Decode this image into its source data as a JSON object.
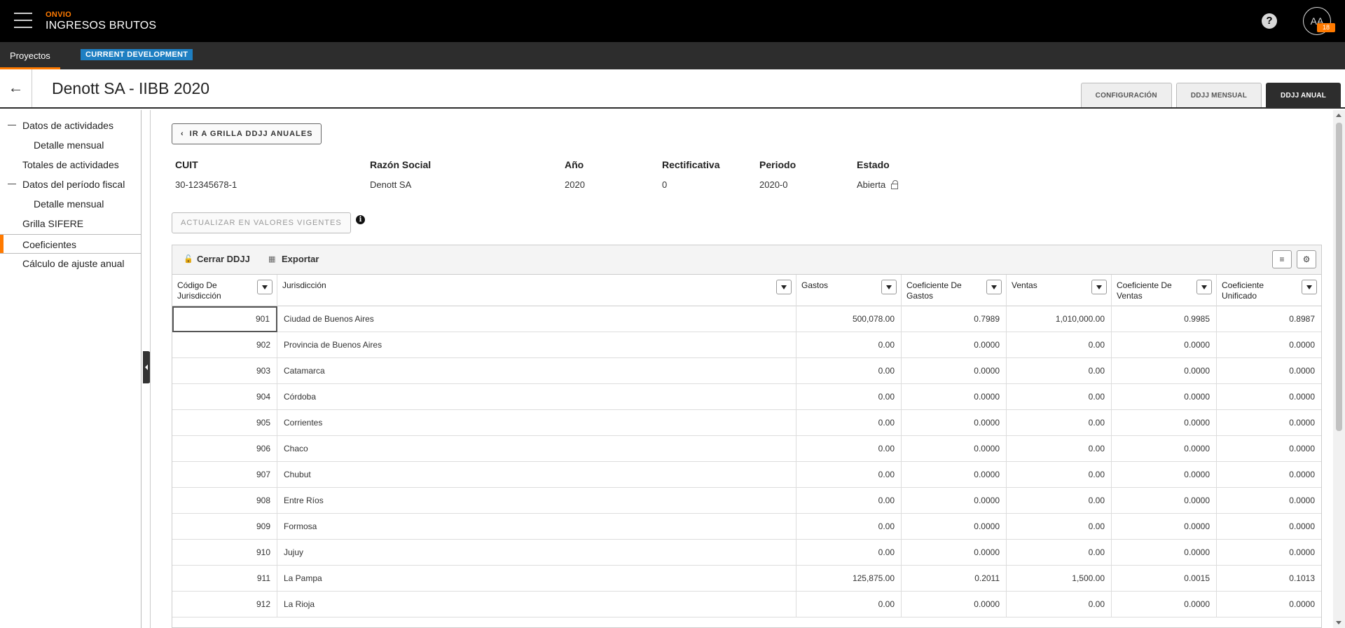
{
  "app": {
    "brand_small": "ONVIO",
    "brand_main": "INGRESOS BRUTOS",
    "help_symbol": "?",
    "avatar_initials": "AA",
    "avatar_badge": "18"
  },
  "nav": {
    "tab": "Proyectos",
    "env_badge": "CURRENT DEVELOPMENT"
  },
  "header": {
    "back_symbol": "←",
    "title": "Denott SA - IIBB 2020",
    "tabs": [
      "CONFIGURACIÓN",
      "DDJJ MENSUAL",
      "DDJJ ANUAL"
    ],
    "active_tab": "DDJJ ANUAL"
  },
  "sidebar": {
    "items": [
      {
        "label": "Datos de actividades"
      },
      {
        "label": "Detalle mensual"
      },
      {
        "label": "Totales de actividades"
      },
      {
        "label": "Datos del período fiscal"
      },
      {
        "label": "Detalle mensual"
      },
      {
        "label": "Grilla SIFERE"
      },
      {
        "label": "Coeficientes"
      },
      {
        "label": "Cálculo de ajuste anual"
      }
    ],
    "active": "Coeficientes"
  },
  "main": {
    "back_grid_button": "IR A GRILLA DDJJ ANUALES",
    "update_button": "ACTUALIZAR EN VALORES VIGENTES",
    "info_symbol": "i",
    "info": {
      "cuit_label": "CUIT",
      "cuit_value": "30-12345678-1",
      "razon_label": "Razón Social",
      "razon_value": "Denott SA",
      "anio_label": "Año",
      "anio_value": "2020",
      "rect_label": "Rectificativa",
      "rect_value": "0",
      "periodo_label": "Periodo",
      "periodo_value": "2020-0",
      "estado_label": "Estado",
      "estado_value": "Abierta"
    }
  },
  "grid": {
    "toolbar": {
      "close_label": "Cerrar DDJJ",
      "export_label": "Exportar"
    },
    "columns": [
      "Código De Jurisdicción",
      "Jurisdicción",
      "Gastos",
      "Coeficiente De Gastos",
      "Ventas",
      "Coeficiente De Ventas",
      "Coeficiente Unificado"
    ],
    "rows": [
      [
        "901",
        "Ciudad de Buenos Aires",
        "500,078.00",
        "0.7989",
        "1,010,000.00",
        "0.9985",
        "0.8987"
      ],
      [
        "902",
        "Provincia de Buenos Aires",
        "0.00",
        "0.0000",
        "0.00",
        "0.0000",
        "0.0000"
      ],
      [
        "903",
        "Catamarca",
        "0.00",
        "0.0000",
        "0.00",
        "0.0000",
        "0.0000"
      ],
      [
        "904",
        "Córdoba",
        "0.00",
        "0.0000",
        "0.00",
        "0.0000",
        "0.0000"
      ],
      [
        "905",
        "Corrientes",
        "0.00",
        "0.0000",
        "0.00",
        "0.0000",
        "0.0000"
      ],
      [
        "906",
        "Chaco",
        "0.00",
        "0.0000",
        "0.00",
        "0.0000",
        "0.0000"
      ],
      [
        "907",
        "Chubut",
        "0.00",
        "0.0000",
        "0.00",
        "0.0000",
        "0.0000"
      ],
      [
        "908",
        "Entre Ríos",
        "0.00",
        "0.0000",
        "0.00",
        "0.0000",
        "0.0000"
      ],
      [
        "909",
        "Formosa",
        "0.00",
        "0.0000",
        "0.00",
        "0.0000",
        "0.0000"
      ],
      [
        "910",
        "Jujuy",
        "0.00",
        "0.0000",
        "0.00",
        "0.0000",
        "0.0000"
      ],
      [
        "911",
        "La Pampa",
        "125,875.00",
        "0.2011",
        "1,500.00",
        "0.0015",
        "0.1013"
      ],
      [
        "912",
        "La Rioja",
        "0.00",
        "0.0000",
        "0.00",
        "0.0000",
        "0.0000"
      ]
    ]
  },
  "colors": {
    "accent": "#ff7a00",
    "topbar": "#000000",
    "navbar": "#2d2d2d",
    "env_badge": "#1e7fc2"
  }
}
